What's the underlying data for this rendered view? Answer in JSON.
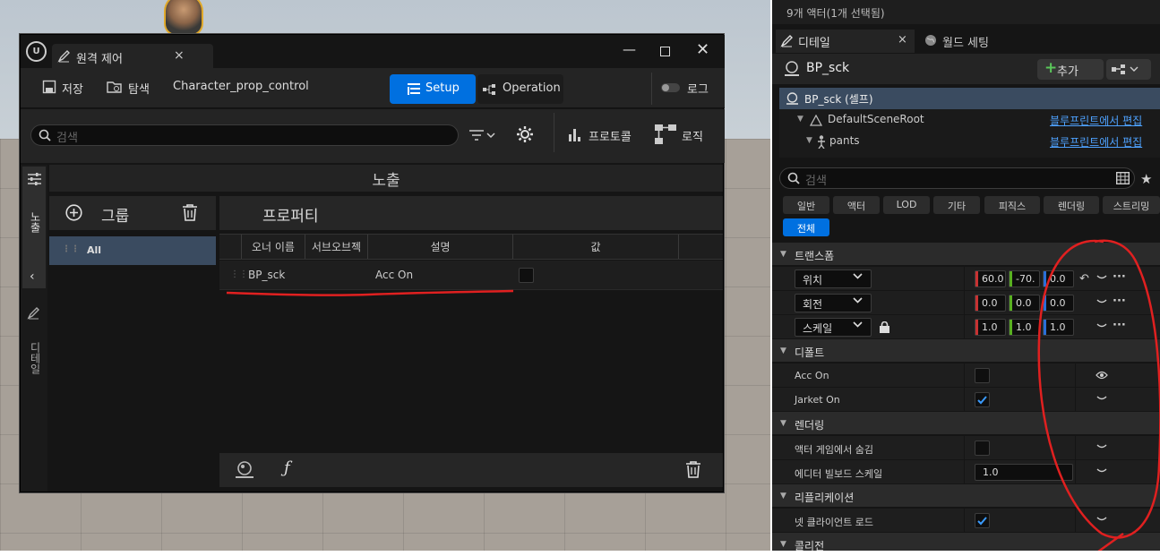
{
  "remote_window": {
    "tab_title": "원격 제어",
    "toolbar": {
      "save_label": "저장",
      "browse_label": "탐색",
      "preset_name": "Character_prop_control",
      "setup_label": "Setup",
      "operation_label": "Operation",
      "log_label": "로그"
    },
    "search_placeholder": "검색",
    "protocol_label": "프로토콜",
    "logic_label": "로직",
    "side_tabs": {
      "expose": "노출",
      "details": "디테일"
    },
    "expose_header": "노출",
    "group_label": "그룹",
    "all_group": "All",
    "property_label": "프로퍼티",
    "columns": [
      "오너 이름",
      "서브오브젝",
      "설명",
      "값"
    ],
    "rows": [
      {
        "owner": "BP_sck",
        "description": "Acc On",
        "value_checked": false
      }
    ]
  },
  "details_panel": {
    "selection_info": "9개 액터(1개 선택됨)",
    "tab_details": "디테일",
    "tab_world": "월드 세팅",
    "actor_name": "BP_sck",
    "add_button": "추가",
    "tree": [
      {
        "label": "BP_sck (셀프)",
        "link": ""
      },
      {
        "label": "DefaultSceneRoot",
        "link": "블루프린트에서 편집"
      },
      {
        "label": "pants",
        "link": "블루프린트에서 편집"
      }
    ],
    "search_placeholder": "검색",
    "filters": [
      "일반",
      "액터",
      "LOD",
      "기타",
      "피직스",
      "렌더링",
      "스트리밍"
    ],
    "filter_all": "전체",
    "sections": {
      "transform": "트랜스폼",
      "default": "디폴트",
      "rendering": "렌더링",
      "replication": "리플리케이션",
      "collision": "콜리전"
    },
    "transform": [
      {
        "label": "위치",
        "x": "60.0",
        "y": "-70.",
        "z": "0.0"
      },
      {
        "label": "회전",
        "x": "0.0",
        "y": "0.0",
        "z": "0.0"
      },
      {
        "label": "스케일",
        "x": "1.0",
        "y": "1.0",
        "z": "1.0"
      }
    ],
    "default_props": [
      {
        "label": "Acc On",
        "checked": false
      },
      {
        "label": "Jarket On",
        "checked": true
      }
    ],
    "render_props": [
      {
        "label": "액터 게임에서 숨김",
        "checked": false
      },
      {
        "label": "에디터 빌보드 스케일",
        "value": "1.0"
      }
    ],
    "replication_props": [
      {
        "label": "넷 클라이언트 로드",
        "checked": true
      }
    ]
  },
  "colors": {
    "accent": "#0070e0",
    "link": "#4ea2ff",
    "annotation": "#e02020",
    "x_axis": "#c83232",
    "y_axis": "#58b020",
    "z_axis": "#2a6fd8"
  }
}
